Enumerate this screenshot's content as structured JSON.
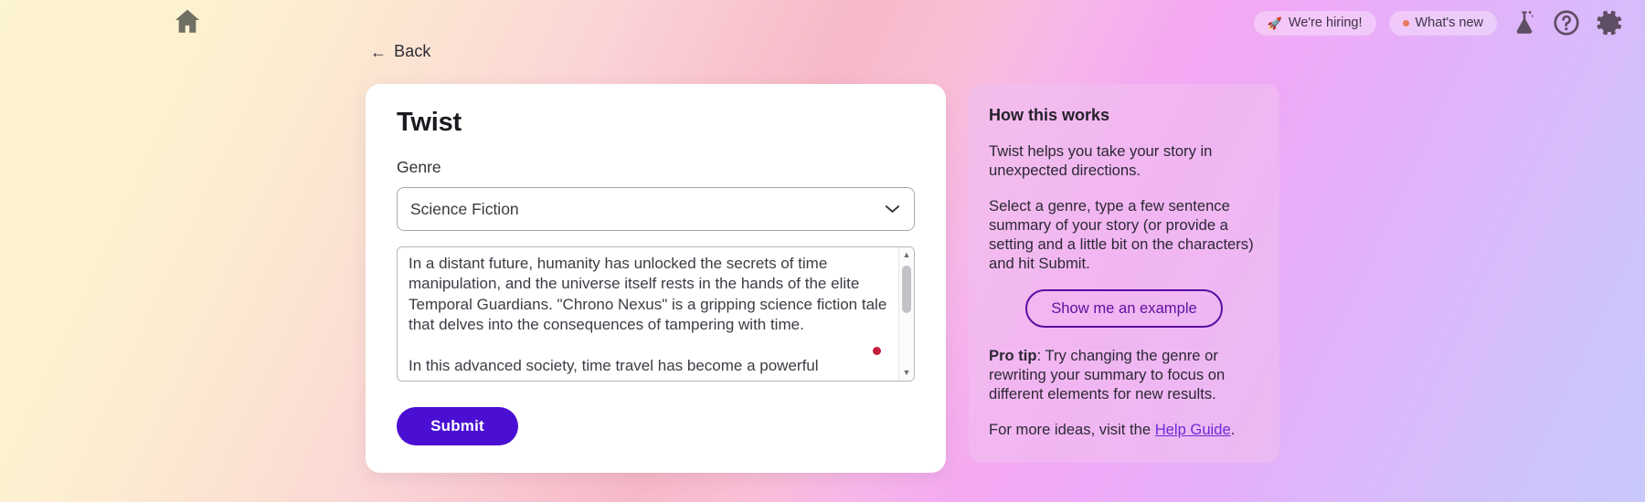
{
  "topbar": {
    "home_icon": "home-icon",
    "hiring_pill": {
      "icon": "rocket-icon",
      "label": "We're hiring!"
    },
    "whats_new_pill": {
      "icon": "dot-indicator",
      "label": "What's new"
    },
    "icons": [
      {
        "name": "flask-icon"
      },
      {
        "name": "help-circle-icon"
      },
      {
        "name": "gear-icon"
      }
    ]
  },
  "back": {
    "arrow": "←",
    "label": "Back"
  },
  "card": {
    "title": "Twist",
    "genre": {
      "label": "Genre",
      "value": "Science Fiction",
      "chevron": "chevron-down-icon",
      "options": [
        "Science Fiction"
      ]
    },
    "summary": {
      "value": "In a distant future, humanity has unlocked the secrets of time manipulation, and the universe itself rests in the hands of the elite Temporal Guardians. \"Chrono Nexus\" is a gripping science fiction tale that delves into the consequences of tampering with time.\n\nIn this advanced society, time travel has become a powerful",
      "placeholder": "",
      "scroll_up_arrow": "▲",
      "scroll_down_arrow": "▼"
    },
    "submit_label": "Submit"
  },
  "side_panel": {
    "title": "How this works",
    "paragraph_1": "Twist helps you take your story in unexpected directions.",
    "paragraph_2": "Select a genre, type a few sentence summary of your story (or provide a setting and a little bit on the characters) and hit Submit.",
    "example_button_label": "Show me an example",
    "tip_prefix": "Pro tip",
    "tip_body": ": Try changing the genre or rewriting your summary to focus on different elements for new results.",
    "footer_text": "For more ideas, visit the ",
    "footer_link": "Help Guide",
    "footer_suffix": "."
  },
  "colors": {
    "submit_bg": "#4b0fd4",
    "example_border": "#5b0da0",
    "link": "#6b2bd6",
    "red_marker": "#c41e3a",
    "new_dot": "#e8795c"
  }
}
